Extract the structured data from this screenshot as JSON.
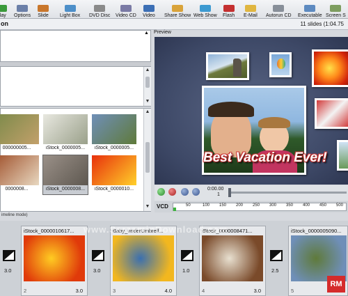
{
  "toolbar": {
    "items": [
      {
        "label": "Play",
        "color": "#3b9a3b"
      },
      {
        "label": "Options",
        "color": "#6b7fa8"
      },
      {
        "label": "Slide",
        "color": "#c9772c"
      },
      {
        "label": "Light Box",
        "color": "#4d8fc9"
      },
      {
        "label": "DVD Disc",
        "color": "#8a8a8a"
      },
      {
        "label": "Video CD",
        "color": "#7a7aa5"
      },
      {
        "label": "Video",
        "color": "#3c6fb5"
      },
      {
        "label": "Share Show",
        "color": "#d9a33a"
      },
      {
        "label": "Web Show",
        "color": "#3d9ad1"
      },
      {
        "label": "Flash",
        "color": "#c43030"
      },
      {
        "label": "E-Mail",
        "color": "#e0b640"
      },
      {
        "label": "Autorun CD",
        "color": "#888f99"
      },
      {
        "label": "Executable",
        "color": "#5d8ac0"
      },
      {
        "label": "Screen S",
        "color": "#7d9d5f"
      }
    ]
  },
  "title": {
    "text": "on",
    "slide_count": "11 slides (1:04.75"
  },
  "library": {
    "thumbnails": [
      {
        "label": "000000005...",
        "c1": "#7b8a4a",
        "c2": "#c2a06a"
      },
      {
        "label": "iStock_0000005...",
        "c1": "#e8e8e0",
        "c2": "#9aa08a"
      },
      {
        "label": "iStock_0000005...",
        "c1": "#6f8fb8",
        "c2": "#5f7a3a"
      },
      {
        "label": "0000008...",
        "c1": "#a0522d",
        "c2": "#e8d8c0"
      },
      {
        "label": "iStock_0000008...",
        "c1": "#9a9088",
        "c2": "#5e5850"
      },
      {
        "label": "iStock_0000010...",
        "c1": "#e8300c",
        "c2": "#ffd02a"
      }
    ]
  },
  "preview": {
    "header": "Preview",
    "caption": "Best Vacation Ever!",
    "time_top": "0:00.00",
    "time_bottom": "1",
    "vcd_label": "VCD",
    "ruler_ticks": [
      "50",
      "100",
      "150",
      "200",
      "250",
      "300",
      "350",
      "400",
      "450",
      "500"
    ],
    "vcd_fill": 0.01
  },
  "storyboard": {
    "header": "imeline mode)",
    "slides": [
      {
        "name": "iStock_0000010617...",
        "num": "2",
        "dur": "3.0",
        "c1": "#e03a0a",
        "c2": "#ffcc22"
      },
      {
        "name": "Baby_underUmbrell...",
        "num": "3",
        "dur": "4.0",
        "c1": "#f2b71f",
        "c2": "#3a6fb0"
      },
      {
        "name": "iStock_0000008471...",
        "num": "4",
        "dur": "3.0",
        "c1": "#7a4a2a",
        "c2": "#e8e0d0"
      },
      {
        "name": "iStock_0000005090...",
        "num": "5",
        "dur": "",
        "c1": "#6f8fb8",
        "c2": "#5f7a3a"
      }
    ],
    "transitions": [
      "3.0",
      "3.0",
      "1.0",
      "2.5"
    ]
  },
  "watermark": "www.SarzaminDownload.com",
  "logo": "RM"
}
